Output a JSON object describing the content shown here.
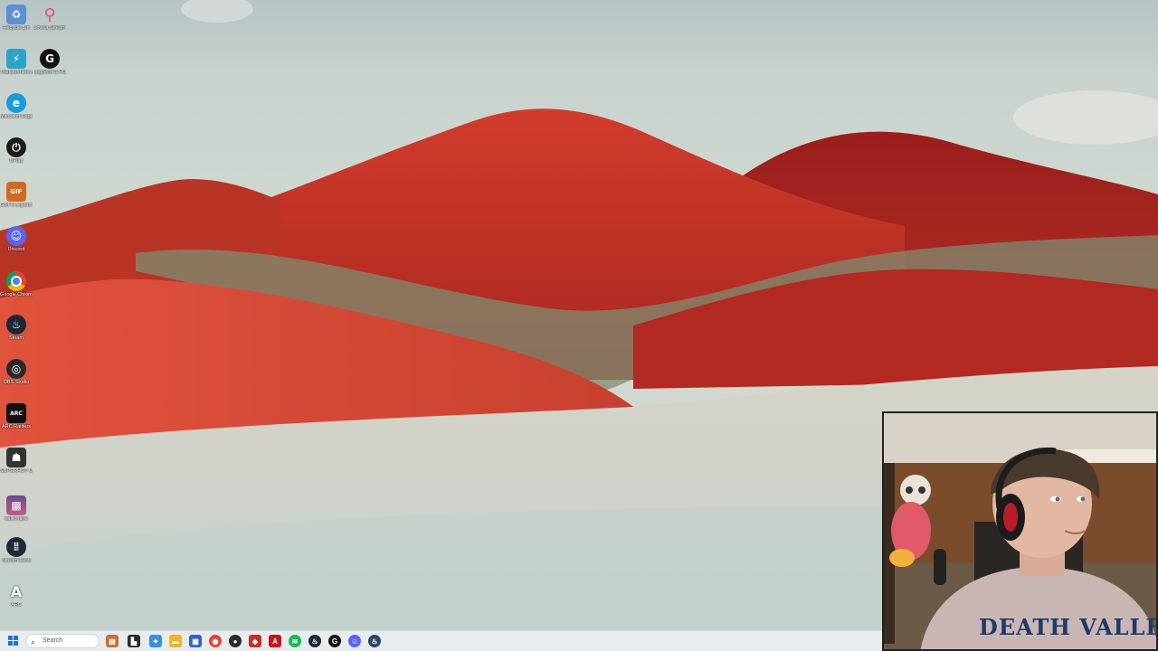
{
  "desktop": {
    "icons": [
      {
        "label": "Recycle Bin",
        "icon": "recycle-bin-icon",
        "color": "#5b8fd6"
      },
      {
        "label": "Lovela Stream",
        "icon": "map-pin-icon",
        "color": "#e94b6e"
      },
      {
        "label": "Transformers Mod Manager",
        "icon": "transformers-icon",
        "color": "#2aa4c8"
      },
      {
        "label": "Logitech G HUB",
        "icon": "logitech-g-icon",
        "color": "#111111"
      },
      {
        "label": "Microsoft Edge",
        "icon": "edge-icon",
        "color": "#1a9ad8"
      },
      {
        "label": "UPlay",
        "icon": "power-icon",
        "color": "#1b1b1b"
      },
      {
        "label": "Golf It Legend Support",
        "icon": "game-logo-icon",
        "color": "#d2691e"
      },
      {
        "label": "Discord",
        "icon": "discord-icon",
        "color": "#5865f2"
      },
      {
        "label": "Google Chrome",
        "icon": "chrome-icon",
        "color": "#db4437"
      },
      {
        "label": "Steam",
        "icon": "steam-icon",
        "color": "#1b2838"
      },
      {
        "label": "OBS Studio",
        "icon": "obs-icon",
        "color": "#2b2b2b"
      },
      {
        "label": "ARC Raiders",
        "icon": "arc-raiders-icon",
        "color": "#111111"
      },
      {
        "label": "SUPERHOT Unleashed",
        "icon": "mask-icon",
        "color": "#333333"
      },
      {
        "label": "ballionaire",
        "icon": "game-art-icon",
        "color": "#6a4a8c"
      },
      {
        "label": "Stream Deck",
        "icon": "stream-deck-icon",
        "color": "#1e2a3a"
      },
      {
        "label": "ARC",
        "icon": "font-a-icon",
        "color": "#444444"
      }
    ]
  },
  "taskbar": {
    "search_placeholder": "Search",
    "apps": [
      {
        "name": "widgets-icon",
        "color": "#c0733a",
        "glyph": "▤"
      },
      {
        "name": "task-view-icon",
        "color": "#2a2a2a",
        "glyph": "▙"
      },
      {
        "name": "copilot-icon",
        "color": "#3b8fe0",
        "glyph": "✦"
      },
      {
        "name": "file-explorer-icon",
        "color": "#f0b429",
        "glyph": "▬"
      },
      {
        "name": "store-icon",
        "color": "#2c66c4",
        "glyph": "▦"
      },
      {
        "name": "chrome-icon",
        "color": "#db4437",
        "glyph": "◉"
      },
      {
        "name": "obs-icon",
        "color": "#2b2b2b",
        "glyph": "●"
      },
      {
        "name": "game-icon",
        "color": "#c4302b",
        "glyph": "◆"
      },
      {
        "name": "adobe-icon",
        "color": "#c4161c",
        "glyph": "A"
      },
      {
        "name": "spotify-icon",
        "color": "#1db954",
        "glyph": "≋"
      },
      {
        "name": "steam-icon",
        "color": "#1b2838",
        "glyph": "♨"
      },
      {
        "name": "logitech-g-icon",
        "color": "#111111",
        "glyph": "G"
      },
      {
        "name": "discord-icon",
        "color": "#5865f2",
        "glyph": "☺"
      },
      {
        "name": "steam-alt-icon",
        "color": "#2a475e",
        "glyph": "♨"
      }
    ]
  },
  "webcam": {
    "shirt_text": "DEATH VALLE"
  }
}
